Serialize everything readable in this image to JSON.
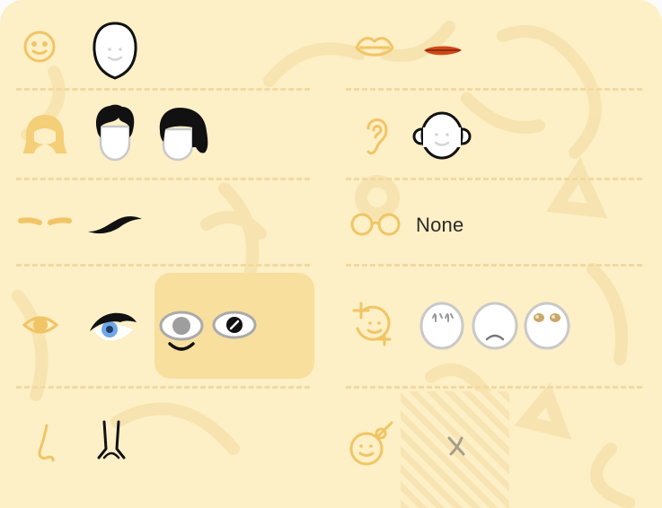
{
  "colors": {
    "panel_background": "#fdefc6",
    "category_icon": "#f0c565",
    "divider": "#f2d9a0",
    "selected_highlight": "#f8df9e",
    "lip": "#d04818",
    "eye_iris": "#6fa7e8"
  },
  "left_column": [
    {
      "category_icon": "face-shape-icon",
      "options": [
        "face-shape-oval"
      ]
    },
    {
      "category_icon": "hair-icon",
      "options": [
        "hair-short-spiky",
        "hair-bob"
      ]
    },
    {
      "category_icon": "eyebrow-icon",
      "options": [
        "eyebrow-arched"
      ]
    },
    {
      "category_icon": "eye-icon",
      "options": [
        "eye-lashed-blue",
        "eye-happy-set-selected"
      ]
    },
    {
      "category_icon": "nose-icon",
      "options": [
        "nose-lines"
      ]
    }
  ],
  "right_column": [
    {
      "category_icon": "mouth-icon",
      "options": [
        "lips-red"
      ]
    },
    {
      "category_icon": "ear-icon",
      "options": [
        "ears-round"
      ]
    },
    {
      "category_icon": "glasses-icon",
      "options": [
        "none"
      ],
      "option_label": "None"
    },
    {
      "category_icon": "blush-effect-icon",
      "options": [
        "face-worried",
        "face-frown",
        "face-shine-cheeks"
      ]
    },
    {
      "category_icon": "face-detail-icon",
      "options": [
        "empty-slot"
      ]
    }
  ],
  "glasses": {
    "none_label": "None"
  }
}
